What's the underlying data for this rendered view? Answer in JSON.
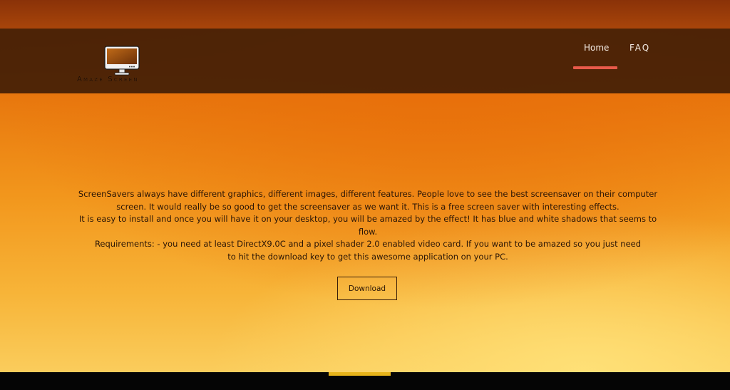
{
  "brand": {
    "name": "Amaze Screen",
    "icon": "monitor-icon"
  },
  "nav": {
    "items": [
      {
        "label": "Home",
        "active": true
      },
      {
        "label": "FAQ",
        "active": false
      }
    ]
  },
  "main": {
    "paragraphs": [
      "ScreenSavers always have different graphics, different images, different features. People love to see the best screensaver on their computer screen. It would really be so good to get the screensaver as we want it. This is a free screen saver with interesting effects.",
      "It is easy to install and once you will have it on your desktop, you will be amazed by the effect! It has blue and white shadows that seems to flow.",
      "Requirements: - you need at least DirectX9.0C and a pixel shader 2.0 enabled video card. If you want to be amazed so you just need",
      "to hit the download key to get this awesome application on your PC."
    ],
    "download_label": "Download"
  },
  "colors": {
    "accent_underline": "#e85a4a",
    "footer_tab": "#e8b41a",
    "header_bg": "#3a1a06",
    "page_orange": "#e8780e",
    "page_yellow": "#fbd264"
  }
}
